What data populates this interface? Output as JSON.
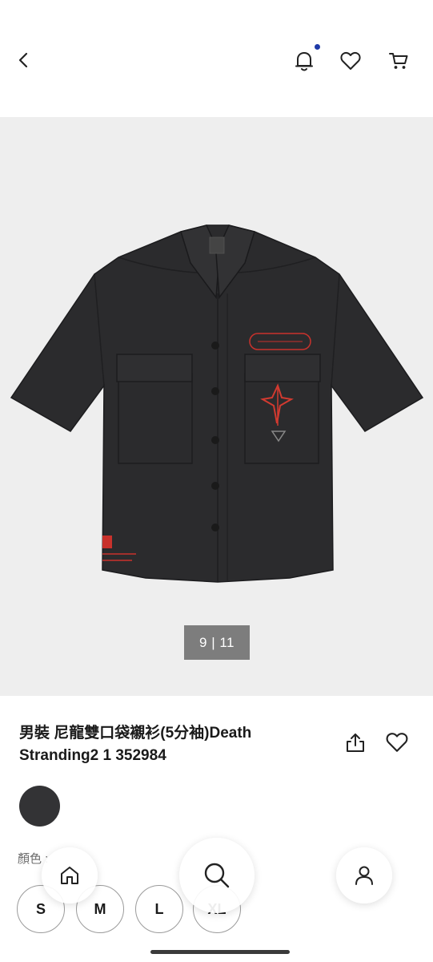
{
  "header": {
    "back_icon": "chevron-left-icon",
    "notification_icon": "bell-icon",
    "notification_dot_color": "#1f3aa8",
    "favorite_icon": "heart-icon",
    "cart_icon": "cart-icon"
  },
  "gallery": {
    "counter": "9 | 11",
    "background": "#eeeeee"
  },
  "product": {
    "title_line1": "男裝 尼龍雙口袋襯衫(5分袖)Death",
    "title_line2": "Stranding2 1 352984",
    "share_icon": "share-icon",
    "favorite_icon": "heart-icon"
  },
  "colors": {
    "label": "顏色 :",
    "swatch_color": "#333335"
  },
  "sizes": [
    "S",
    "M",
    "L",
    "XL"
  ],
  "floating_nav": {
    "home_icon": "home-icon",
    "search_icon": "search-icon",
    "user_icon": "user-icon"
  }
}
